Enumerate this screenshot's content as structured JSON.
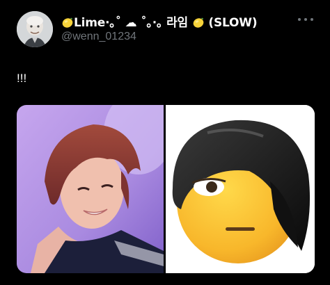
{
  "tweet": {
    "author": {
      "display_name_prefix": "Lime·｡˚ ☁ ˚｡·｡ 라임 ",
      "display_name_suffix": " (SLOW)",
      "handle": "@wenn_01234"
    },
    "text": "!!!",
    "media": [
      {
        "kind": "photo",
        "icon": "person-photo"
      },
      {
        "kind": "photo",
        "icon": "emo-hair-emoji"
      }
    ]
  },
  "colors": {
    "background": "#000000",
    "primary_text": "#ffffff",
    "secondary_text": "#71767b"
  }
}
